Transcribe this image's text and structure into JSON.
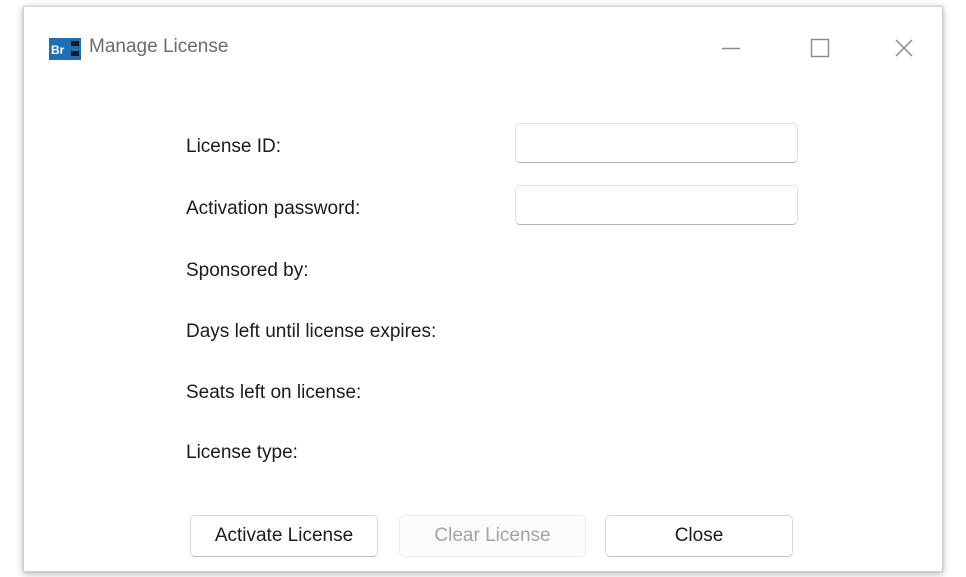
{
  "window": {
    "title": "Manage License",
    "icon_name": "bridge-app-icon",
    "controls": {
      "minimize": "minimize-icon",
      "maximize": "maximize-icon",
      "close": "close-icon"
    }
  },
  "form": {
    "license_id_label": "License ID:",
    "license_id_value": "",
    "activation_password_label": "Activation password:",
    "activation_password_value": "",
    "sponsored_by_label": "Sponsored by:",
    "days_left_label": "Days left until license expires:",
    "seats_left_label": "Seats left on license:",
    "license_type_label": "License type:"
  },
  "buttons": {
    "activate_label": "Activate License",
    "clear_label": "Clear License",
    "close_label": "Close"
  },
  "colors": {
    "icon_blue": "#1f6fb5",
    "icon_black": "#1a1a1a",
    "disabled_text": "#a3a3a3"
  }
}
